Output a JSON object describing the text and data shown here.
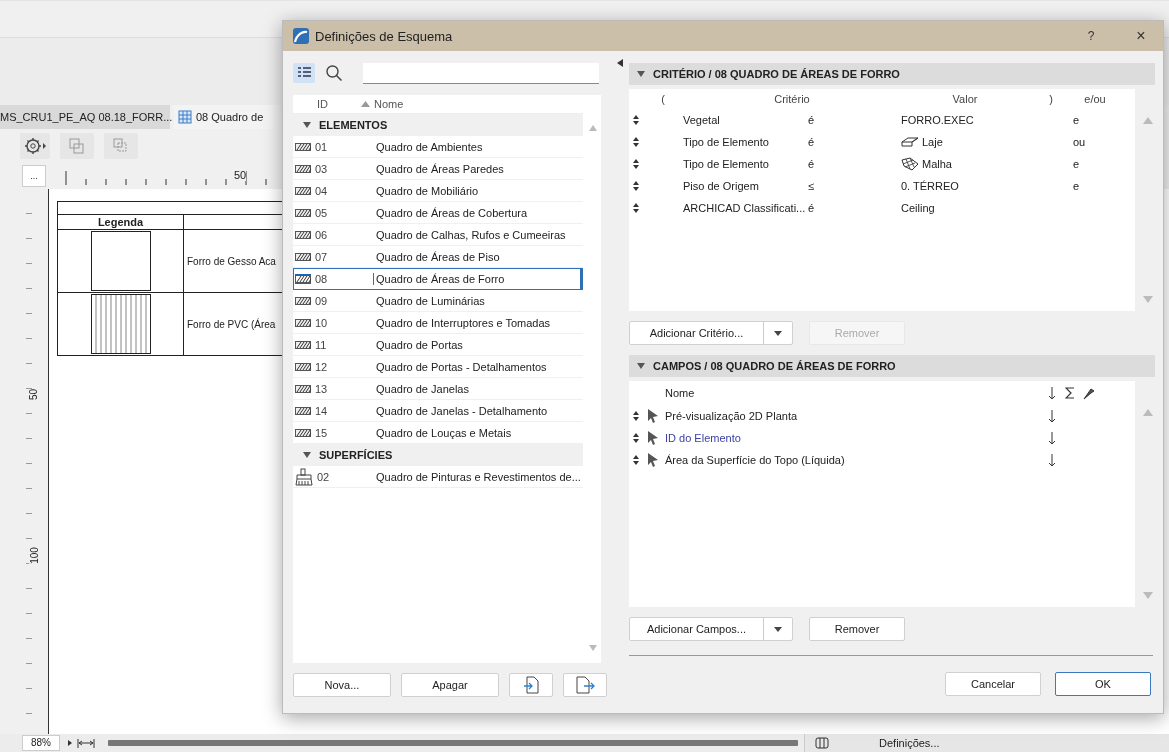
{
  "app": {
    "tabs": [
      {
        "label": "MS_CRU1_PE_AQ 08.18_FORR...",
        "selected": false
      },
      {
        "label": "08 Quadro de",
        "selected": true
      }
    ],
    "ruler_button": "...",
    "ruler_marks": [
      "50"
    ],
    "vertical_ruler_marks": [
      "50",
      "100"
    ],
    "legend_table": {
      "header": "Legenda",
      "rows": [
        {
          "label": "Forro de Gesso Aca",
          "kind": "plain"
        },
        {
          "label": "Forro de PVC (Área",
          "kind": "stripes"
        }
      ]
    },
    "zoom": "88%",
    "settings_button": "Definições..."
  },
  "dialog": {
    "title": "Definições de Esquema",
    "help": "?",
    "close": "×",
    "list": {
      "columns": [
        "ID",
        "Nome"
      ],
      "groups": [
        {
          "label": "ELEMENTOS",
          "expanded": true,
          "items": [
            {
              "kind": "element",
              "id": "01",
              "name": "Quadro de Ambientes",
              "selected": false
            },
            {
              "kind": "element",
              "id": "03",
              "name": "Quadro de Áreas Paredes",
              "selected": false
            },
            {
              "kind": "element",
              "id": "04",
              "name": "Quadro de Mobiliário",
              "selected": false
            },
            {
              "kind": "element",
              "id": "05",
              "name": "Quadro de Áreas de Cobertura",
              "selected": false
            },
            {
              "kind": "element",
              "id": "06",
              "name": "Quadro de Calhas, Rufos e Cumeeiras",
              "selected": false
            },
            {
              "kind": "element",
              "id": "07",
              "name": "Quadro de Áreas de Piso",
              "selected": false
            },
            {
              "kind": "element",
              "id": "08",
              "name": "Quadro de Áreas de Forro",
              "selected": true
            },
            {
              "kind": "element",
              "id": "09",
              "name": "Quadro de Luminárias",
              "selected": false
            },
            {
              "kind": "element",
              "id": "10",
              "name": "Quadro de Interruptores e Tomadas",
              "selected": false
            },
            {
              "kind": "element",
              "id": "11",
              "name": "Quadro de Portas",
              "selected": false
            },
            {
              "kind": "element",
              "id": "12",
              "name": "Quadro de Portas - Detalhamentos",
              "selected": false
            },
            {
              "kind": "element",
              "id": "13",
              "name": "Quadro de Janelas",
              "selected": false
            },
            {
              "kind": "element",
              "id": "14",
              "name": "Quadro de Janelas - Detalhamento",
              "selected": false
            },
            {
              "kind": "element",
              "id": "15",
              "name": "Quadro de Louças e Metais",
              "selected": false
            }
          ]
        },
        {
          "label": "SUPERFÍCIES",
          "expanded": true,
          "items": [
            {
              "kind": "surface",
              "id": "02",
              "name": "Quadro de Pinturas e Revestimentos de...",
              "selected": false
            }
          ]
        }
      ]
    },
    "list_buttons": [
      "Nova...",
      "Apagar"
    ],
    "criteria": {
      "title": "CRITÉRIO / 08 QUADRO DE ÁREAS DE FORRO",
      "expanded": true,
      "columns": [
        "(",
        "Critério",
        "Valor",
        ")",
        "e/ou"
      ],
      "rows": [
        {
          "kind": "text",
          "criterion": "Vegetal",
          "operator": "é",
          "value": "FORRO.EXEC",
          "logic": "e"
        },
        {
          "kind": "slab",
          "criterion": "Tipo de Elemento",
          "operator": "é",
          "value": "Laje",
          "logic": "ou"
        },
        {
          "kind": "mesh",
          "criterion": "Tipo de Elemento",
          "operator": "é",
          "value": "Malha",
          "logic": "e"
        },
        {
          "kind": "text",
          "criterion": "Piso de Origem",
          "operator": "≤",
          "value": "0. TÉRREO",
          "logic": "e"
        },
        {
          "kind": "text",
          "criterion": "ARCHICAD Classificati...",
          "operator": "é",
          "value": "Ceiling"
        }
      ],
      "add_button": "Adicionar Critério...",
      "remove_button": {
        "label": "Remover",
        "disabled": true
      }
    },
    "fields": {
      "title": "CAMPOS / 08 QUADRO DE ÁREAS DE FORRO",
      "expanded": true,
      "name_column": "Nome",
      "rows": [
        {
          "name": "Pré-visualização 2D Planta",
          "linked": false
        },
        {
          "name": "ID do Elemento",
          "linked": true
        },
        {
          "name": "Área da Superfície do Topo (Líquida)",
          "linked": false
        }
      ],
      "add_button": "Adicionar Campos...",
      "remove_button": {
        "label": "Remover",
        "disabled": false
      }
    },
    "buttons": [
      {
        "label": "Cancelar",
        "default": false
      },
      {
        "label": "OK",
        "default": true
      }
    ]
  }
}
